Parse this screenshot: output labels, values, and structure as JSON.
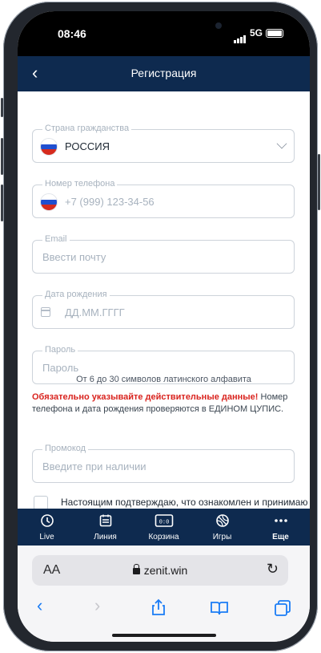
{
  "status": {
    "time": "08:46",
    "network": "5G"
  },
  "header": {
    "title": "Регистрация"
  },
  "form": {
    "country": {
      "label": "Страна гражданства",
      "value": "РОССИЯ"
    },
    "phone": {
      "label": "Номер телефона",
      "placeholder": "+7 (999) 123-34-56"
    },
    "email": {
      "label": "Email",
      "placeholder": "Ввести почту"
    },
    "birth": {
      "label": "Дата рождения",
      "placeholder": "ДД.ММ.ГГГГ"
    },
    "password": {
      "label": "Пароль",
      "placeholder": "Пароль"
    },
    "password_hint": "От 6 до 30 символов латинского алфавита",
    "warning_bold": "Обязательно указывайте действительные данные!",
    "warning_text": " Номер телефона и дата рождения проверяются в ЕДИНОМ ЦУПИС.",
    "promo": {
      "label": "Промокод",
      "placeholder": "Введите при наличии"
    },
    "consent": "Настоящим подтверждаю, что ознакомлен и принимаю"
  },
  "tabbar": {
    "live": "Live",
    "line": "Линия",
    "cart": "Корзина",
    "games": "Игры",
    "more": "Еще"
  },
  "browser": {
    "aa": "AA",
    "url": "zenit.win"
  },
  "colors": {
    "header": "#0e2a4f",
    "accent": "#1a7cf5",
    "warning": "#d9231e"
  },
  "icons": [
    "back-chevron-icon",
    "chevron-down-icon",
    "calendar-icon",
    "clock-icon",
    "calendar-list-icon",
    "scoreboard-icon",
    "ball-icon",
    "more-dots-icon",
    "lock-icon",
    "reload-icon",
    "share-icon",
    "book-icon",
    "tabs-icon"
  ]
}
